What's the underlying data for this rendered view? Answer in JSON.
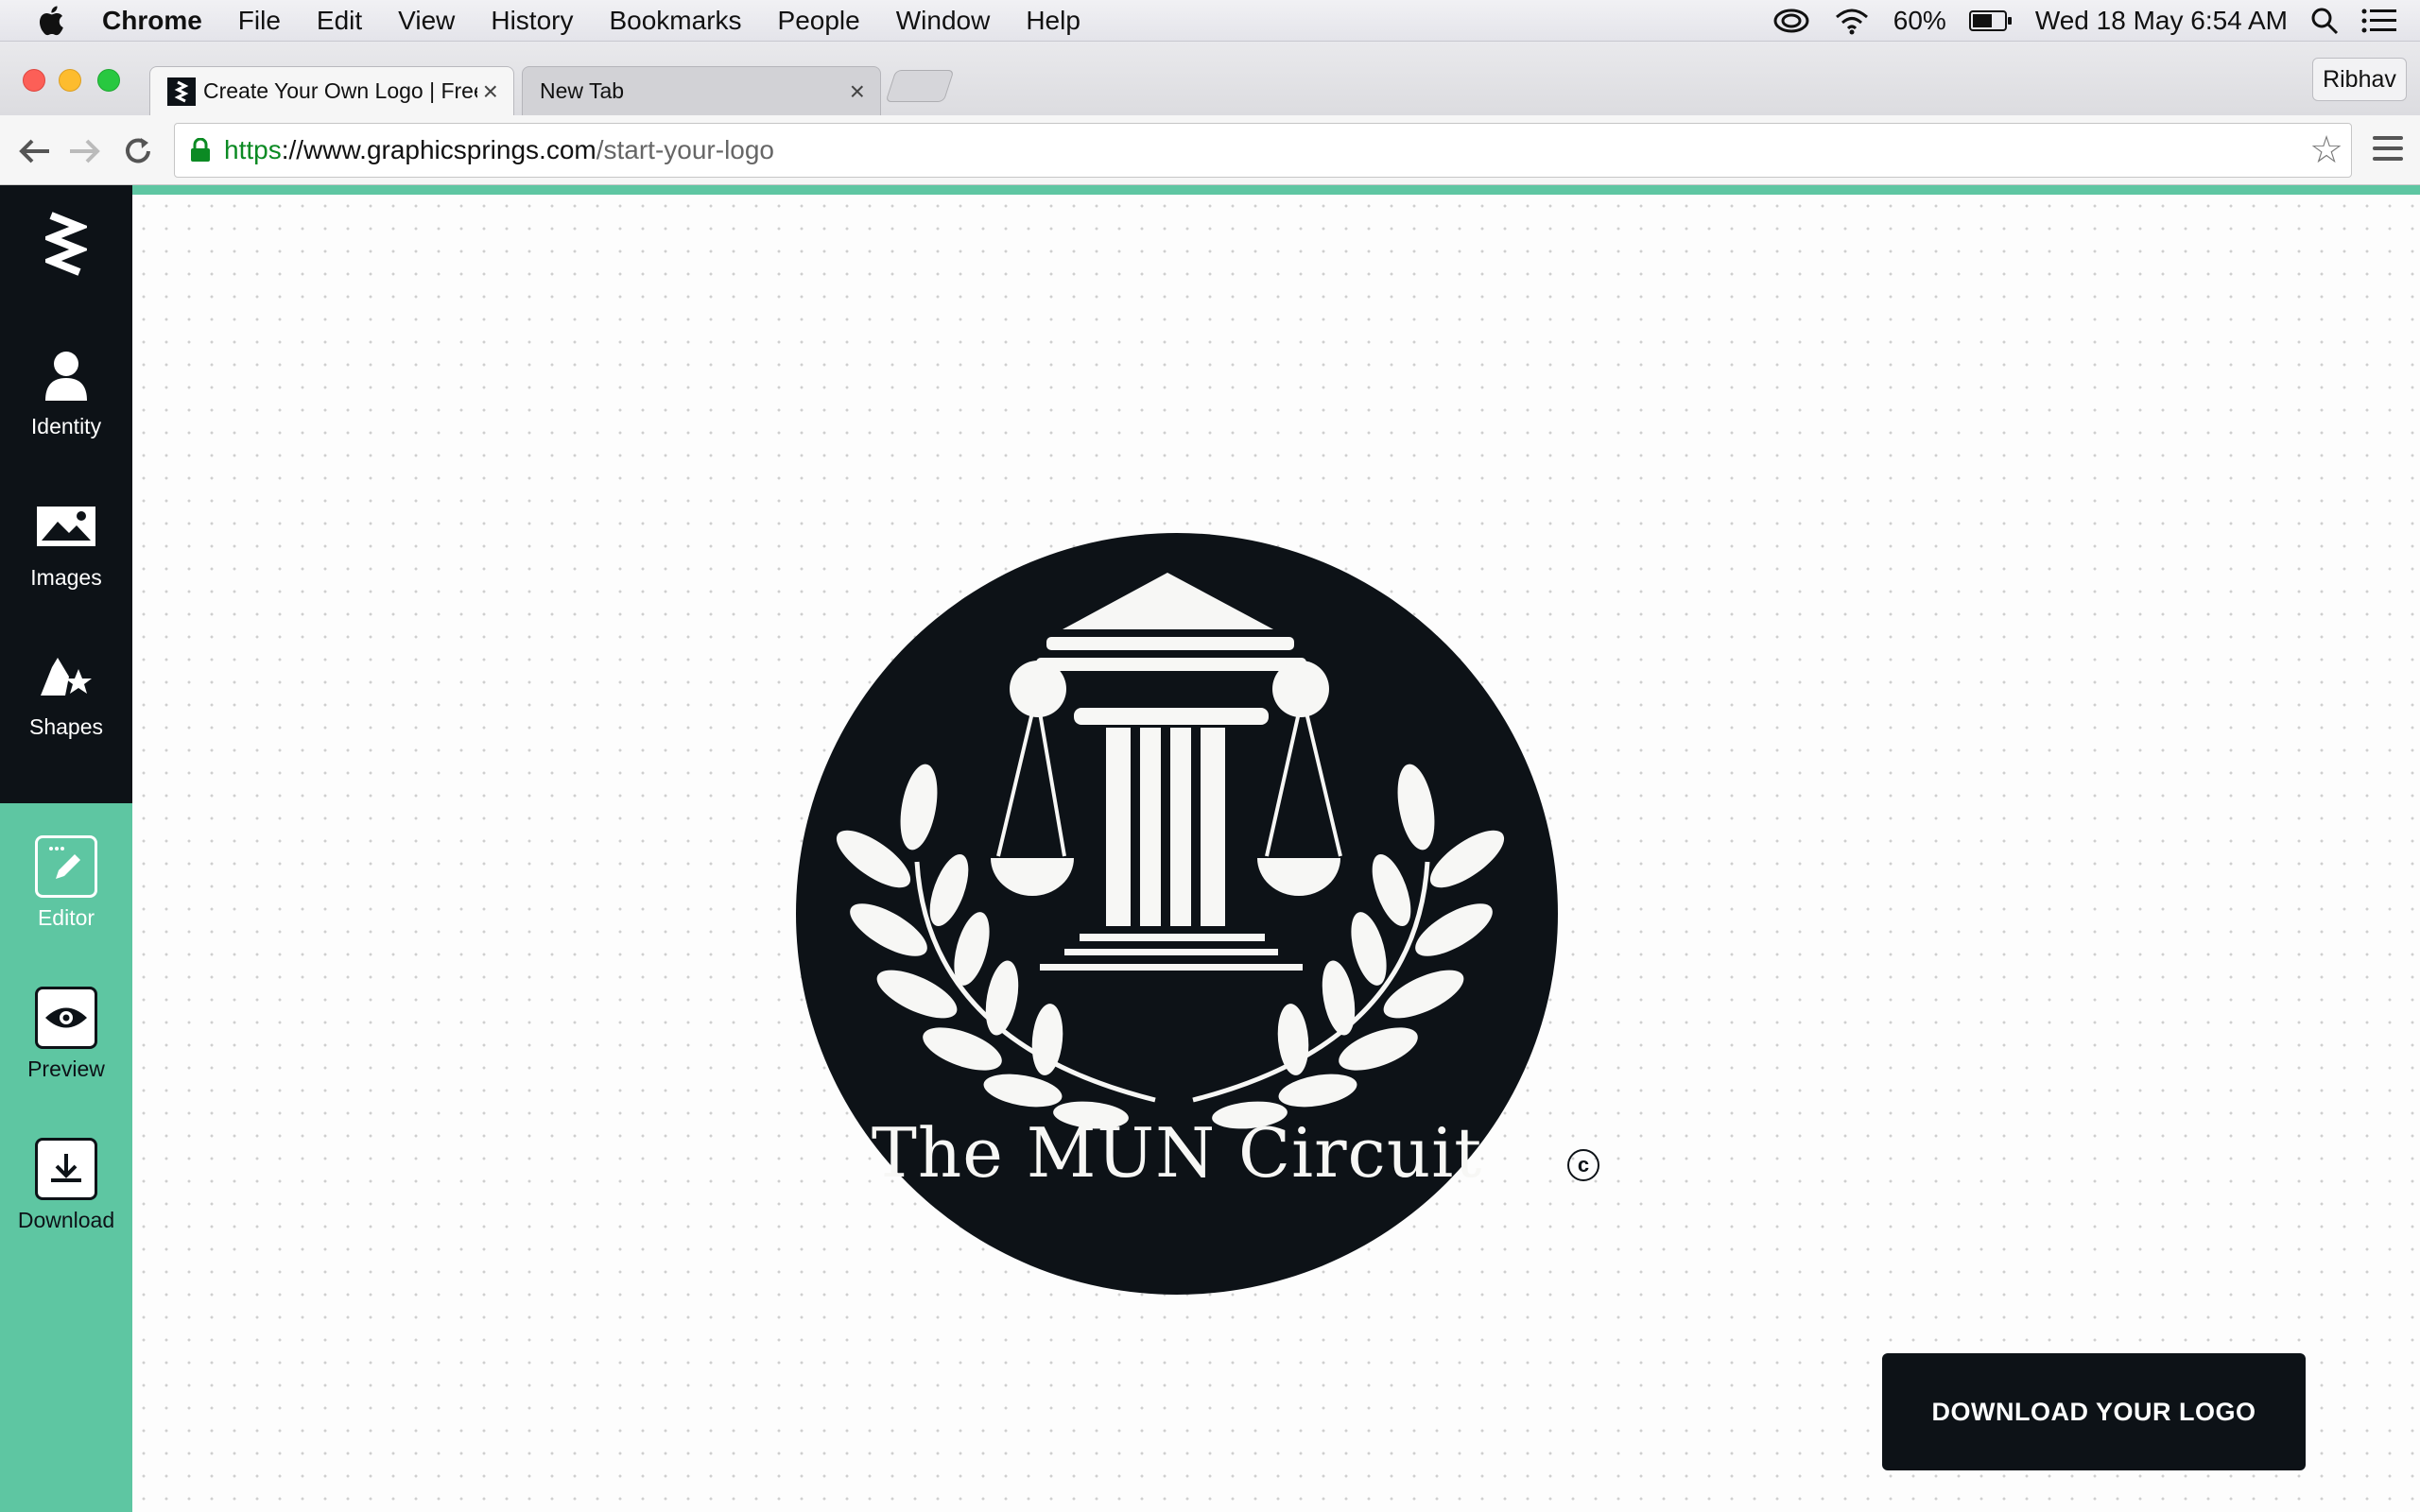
{
  "menubar": {
    "app_name": "Chrome",
    "items": [
      "File",
      "Edit",
      "View",
      "History",
      "Bookmarks",
      "People",
      "Window",
      "Help"
    ],
    "battery_percent": "60%",
    "datetime": "Wed 18 May  6:54 AM",
    "icons": [
      "apple-icon",
      "creative-cloud-icon",
      "wifi-icon",
      "battery-icon",
      "spotlight-icon",
      "notification-center-icon"
    ]
  },
  "browser": {
    "tabs": [
      {
        "title": "Create Your Own Logo | Free",
        "active": true
      },
      {
        "title": "New Tab",
        "active": false
      }
    ],
    "profile_name": "Ribhav",
    "url": {
      "scheme": "https",
      "separator": "://",
      "domain": "www.graphicsprings.com",
      "path": "/start-your-logo"
    }
  },
  "sidebar": {
    "items": [
      {
        "label": "Identity",
        "icon": "person-icon"
      },
      {
        "label": "Images",
        "icon": "image-icon"
      },
      {
        "label": "Shapes",
        "icon": "shapes-icon"
      },
      {
        "label": "Editor",
        "icon": "pencil-icon"
      },
      {
        "label": "Preview",
        "icon": "eye-icon"
      },
      {
        "label": "Download",
        "icon": "download-icon"
      }
    ]
  },
  "canvas": {
    "logo_text": "The MUN Circuit",
    "copyright_symbol": "c"
  },
  "actions": {
    "download_label": "DOWNLOAD YOUR LOGO"
  },
  "colors": {
    "accent": "#5ec6a2",
    "dark": "#0d1217"
  }
}
